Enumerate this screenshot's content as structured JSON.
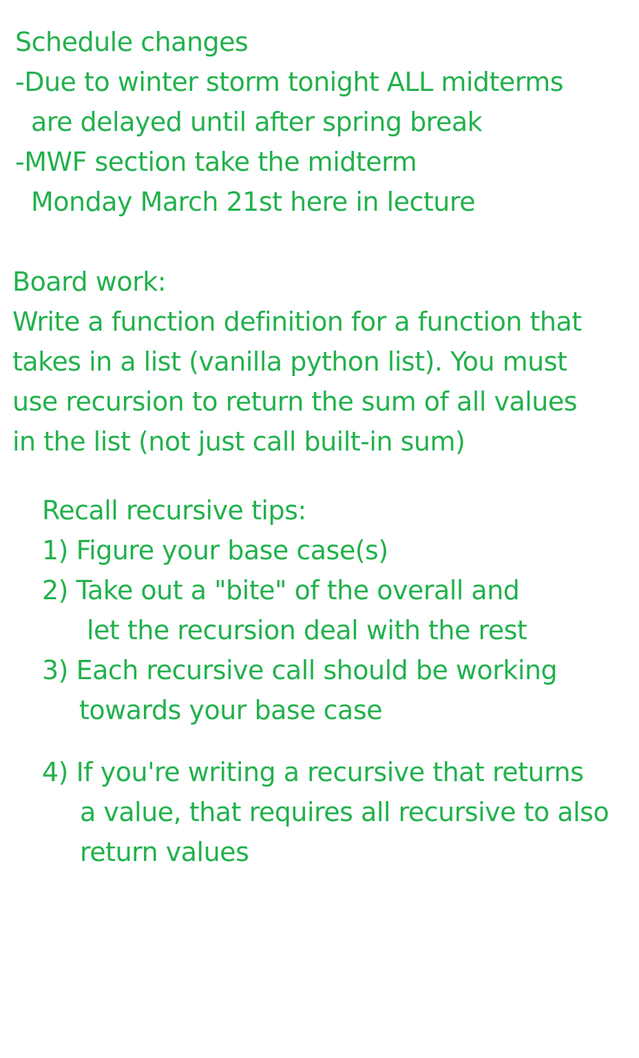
{
  "theme": {
    "text_color": "#22b14c",
    "background": "#ffffff"
  },
  "schedule": {
    "heading": "Schedule changes",
    "lines": [
      "-Due to winter storm tonight ALL midterms",
      "are delayed until after spring break",
      "-MWF section take the midterm",
      "Monday March 21st here in lecture"
    ]
  },
  "board_work": {
    "heading": "Board work:",
    "lines": [
      "Write a function definition for a function that",
      "takes in a list (vanilla python list). You must",
      "use recursion to return the sum of all values",
      "in the list (not just call built-in sum)"
    ]
  },
  "tips": {
    "heading": "Recall recursive tips:",
    "lines": [
      "1) Figure your base case(s)",
      "2) Take out a \"bite\" of the overall and",
      "let the recursion deal with the rest",
      "3) Each recursive call should be working",
      "towards your base case",
      "4) If you're writing a recursive that returns",
      "a value, that requires all recursive to also",
      "return values"
    ]
  }
}
